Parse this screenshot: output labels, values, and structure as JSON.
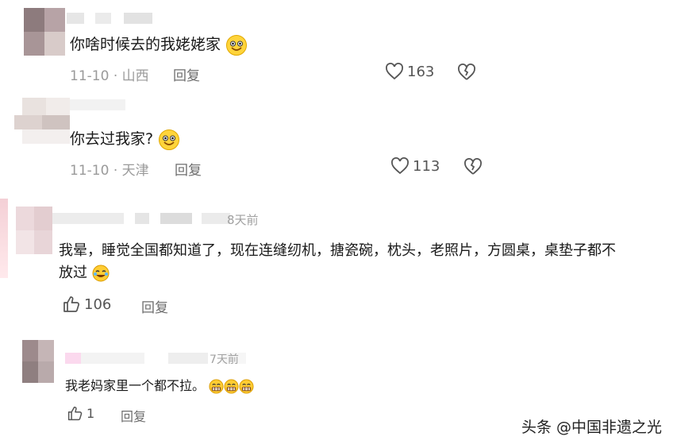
{
  "comments": [
    {
      "text": "你啥时候去的我姥姥家",
      "date": "11-10",
      "location": "山西",
      "reply_label": "回复",
      "likes": "163"
    },
    {
      "text": "你去过我家?",
      "date": "11-10",
      "location": "天津",
      "reply_label": "回复",
      "likes": "113"
    },
    {
      "time_ago": "8天前",
      "text_line1": "我晕，睡觉全国都知道了，现在连缝纫机，搪瓷碗，枕头，老照片，方圆桌，桌垫子都不",
      "text_line2": "放过",
      "likes": "106",
      "reply_label": "回复"
    },
    {
      "time_ago": "7天前",
      "text": "我老妈家里一个都不拉。",
      "likes": "1",
      "reply_label": "回复"
    }
  ],
  "separator": "·",
  "watermark": "头条 @中国非遗之光",
  "icons": [
    "smile-emoji-icon",
    "heart-icon",
    "broken-heart-icon",
    "thumbs-up-icon",
    "laugh-cry-emoji-icon",
    "grin-emoji-icon"
  ]
}
